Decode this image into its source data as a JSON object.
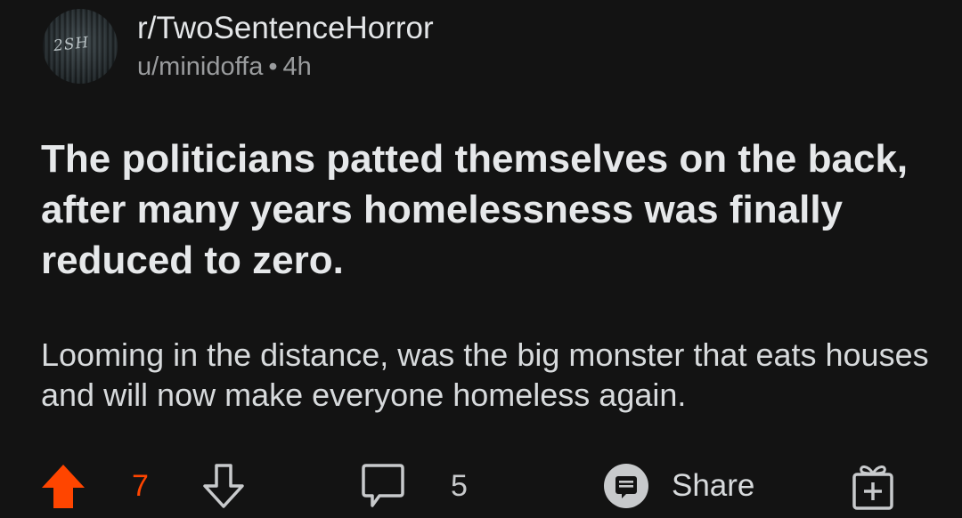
{
  "header": {
    "avatar_text": "2SH",
    "subreddit": "r/TwoSentenceHorror",
    "username": "u/minidoffa",
    "separator": "•",
    "age": "4h"
  },
  "post": {
    "title": "The politicians patted themselves on the back, after many years homelessness was finally reduced to zero.",
    "body": "Looming in the distance, was the big monster that eats houses and will now make everyone homeless again."
  },
  "actions": {
    "upvote_count": "7",
    "comment_count": "5",
    "share_label": "Share"
  },
  "colors": {
    "background": "#131313",
    "upvote_active": "#ff4500",
    "text": "#d7dadc",
    "muted": "#9a9c9e"
  }
}
